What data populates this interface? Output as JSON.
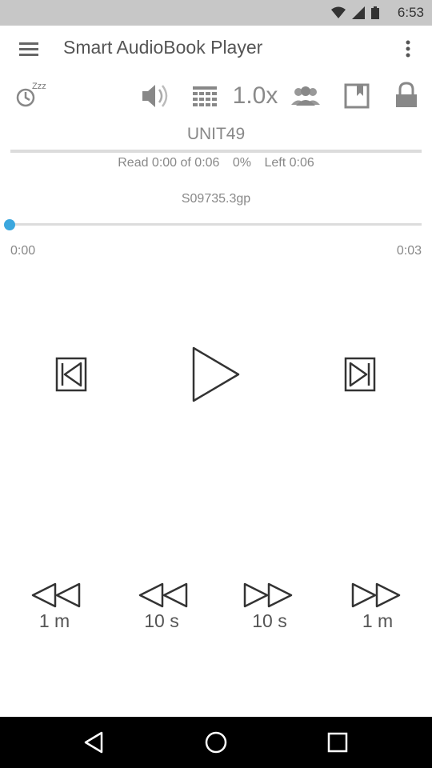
{
  "status_bar": {
    "time": "6:53"
  },
  "app_bar": {
    "title": "Smart AudioBook Player"
  },
  "toolbar": {
    "speed": "1.0x",
    "sleep_label": "Zzz"
  },
  "book": {
    "name": "UNIT49"
  },
  "book_progress": {
    "read": "Read 0:00 of 0:06",
    "percent": "0%",
    "left": "Left 0:06",
    "fraction": 0.0
  },
  "track": {
    "file": "S09735.3gp",
    "start": "0:00",
    "end": "0:03",
    "position_fraction": 0.0
  },
  "jumps": {
    "back_1m": "1 m",
    "back_10s": "10 s",
    "fwd_10s": "10 s",
    "fwd_1m": "1 m"
  },
  "colors": {
    "accent": "#3ba7de",
    "icon": "#8a8a8a"
  }
}
